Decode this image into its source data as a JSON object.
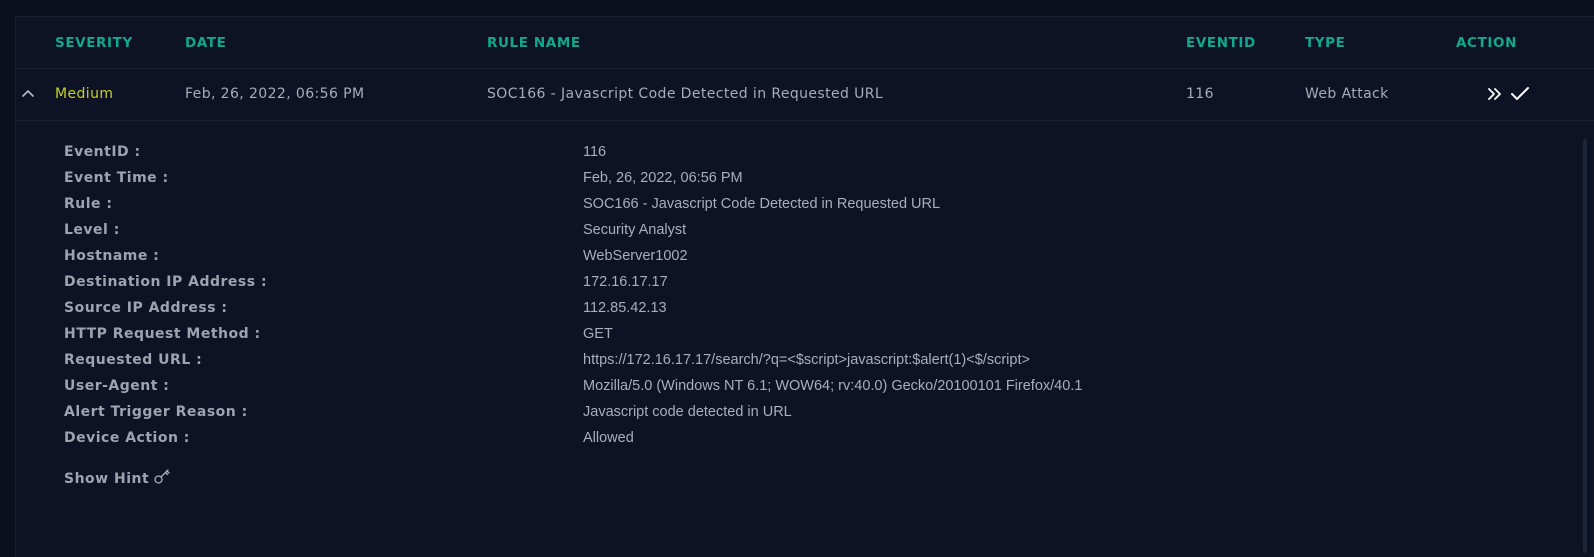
{
  "table": {
    "columns": {
      "severity": "SEVERITY",
      "date": "DATE",
      "rule_name": "RULE NAME",
      "eventid": "EVENTID",
      "type": "TYPE",
      "action": "ACTION"
    },
    "row": {
      "severity": "Medium",
      "severity_color": "#c8cf2b",
      "date": "Feb, 26, 2022, 06:56 PM",
      "rule_name": "SOC166 - Javascript Code Detected in Requested URL",
      "eventid": "116",
      "type": "Web Attack",
      "actions": [
        "double-chevron-right-icon",
        "checkmark-icon"
      ],
      "expanded_icon": "chevron-up-icon"
    }
  },
  "details": {
    "fields": [
      {
        "label": "EventID :",
        "value": "116"
      },
      {
        "label": "Event Time :",
        "value": "Feb, 26, 2022, 06:56 PM"
      },
      {
        "label": "Rule :",
        "value": "SOC166 - Javascript Code Detected in Requested URL"
      },
      {
        "label": "Level :",
        "value": "Security Analyst"
      },
      {
        "label": "Hostname :",
        "value": "WebServer1002"
      },
      {
        "label": "Destination IP Address :",
        "value": "172.16.17.17"
      },
      {
        "label": "Source IP Address :",
        "value": "112.85.42.13"
      },
      {
        "label": "HTTP Request Method :",
        "value": "GET"
      },
      {
        "label": "Requested URL :",
        "value": "https://172.16.17.17/search/?q=<$script>javascript:$alert(1)<$/script>"
      },
      {
        "label": "User-Agent :",
        "value": "Mozilla/5.0 (Windows NT 6.1; WOW64; rv:40.0) Gecko/20100101 Firefox/40.1"
      },
      {
        "label": "Alert Trigger Reason :",
        "value": "Javascript code detected in URL"
      },
      {
        "label": "Device Action :",
        "value": "Allowed"
      }
    ],
    "hint_label": "Show Hint",
    "hint_icon": "key-icon"
  },
  "colors": {
    "accent": "#12a88f",
    "background": "#0d1325",
    "text": "#a9aeba"
  }
}
